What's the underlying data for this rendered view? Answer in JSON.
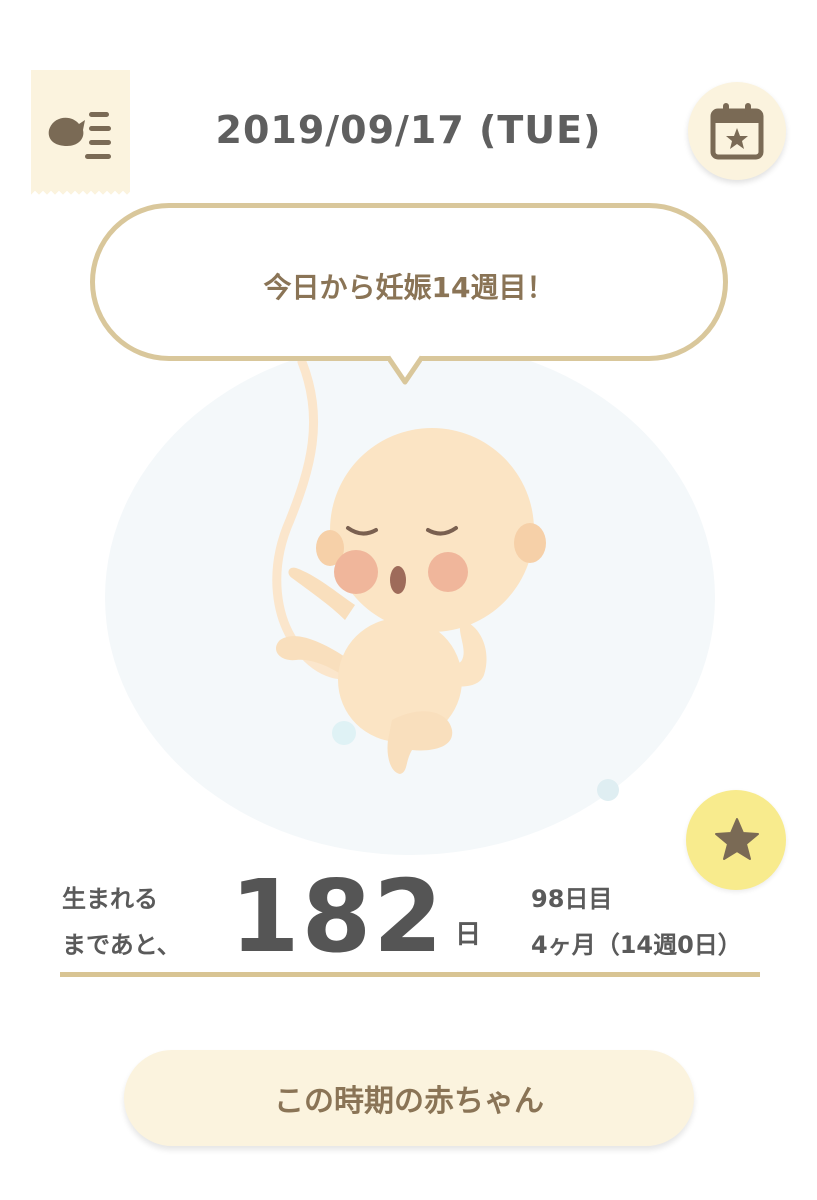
{
  "header": {
    "date": "2019/09/17 (TUE)",
    "menu_icon": "bird-menu-icon",
    "calendar_icon": "calendar-star-icon"
  },
  "bubble": {
    "text": "今日から妊娠14週目！"
  },
  "illustration": {
    "subject": "fetus-illustration"
  },
  "favorite": {
    "icon": "star-icon"
  },
  "countdown": {
    "label_line1": "生まれる",
    "label_line2": "まであと、",
    "days": "182",
    "unit": "日",
    "elapsed_days": "98日目",
    "month_week": "4ヶ月（14週0日）"
  },
  "actions": {
    "baby_this_period": "この時期の赤ちゃん"
  },
  "colors": {
    "accent": "#d9c79b",
    "tag_bg": "#fbf3de",
    "star_bg": "#f8eb8d",
    "text_brown": "#8a7456",
    "icon_brown": "#7a6a55"
  }
}
